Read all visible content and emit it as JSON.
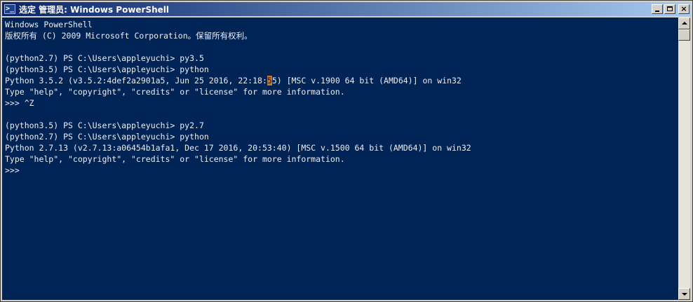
{
  "window": {
    "title": "选定 管理员: Windows PowerShell",
    "app_icon_glyph": ">_",
    "controls": {
      "minimize": "",
      "maximize": "",
      "close": "×"
    }
  },
  "console": {
    "bg_color": "#012456",
    "fg_color": "#eeedf0",
    "cursor_color": "#e07000",
    "lines": [
      "Windows PowerShell",
      "版权所有 (C) 2009 Microsoft Corporation。保留所有权利。",
      "",
      "(python2.7) PS C:\\Users\\appleyuchi> py3.5",
      "(python3.5) PS C:\\Users\\appleyuchi> python",
      "Python 3.5.2 (v3.5.2:4def2a2901a5, Jun 25 2016, 22:18:55) [MSC v.1900 64 bit (AMD64)] on win32",
      "Type \"help\", \"copyright\", \"credits\" or \"license\" for more information.",
      ">>> ^Z",
      "",
      "(python3.5) PS C:\\Users\\appleyuchi> py2.7",
      "(python2.7) PS C:\\Users\\appleyuchi> python",
      "Python 2.7.13 (v2.7.13:a06454b1afa1, Dec 17 2016, 20:53:40) [MSC v.1500 64 bit (AMD64)] on win32",
      "Type \"help\", \"copyright\", \"credits\" or \"license\" for more information.",
      ">>>"
    ],
    "cursor": {
      "line": 5,
      "char": 54
    }
  }
}
